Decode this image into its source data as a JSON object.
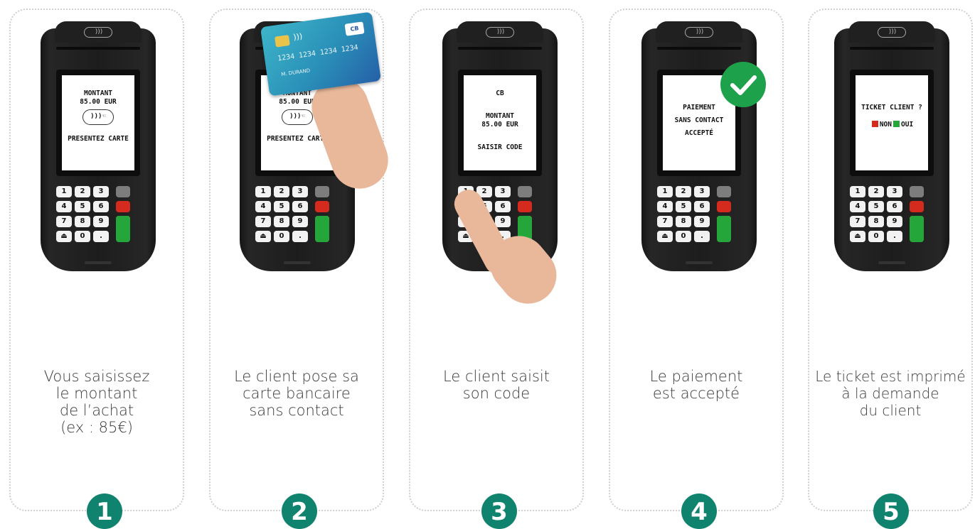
{
  "steps": [
    {
      "number": "1",
      "caption": [
        "Vous saisissez",
        "le montant",
        "de l’achat",
        "(ex : 85€)"
      ]
    },
    {
      "number": "2",
      "caption": [
        "Le client pose sa",
        "carte bancaire",
        "sans contact"
      ]
    },
    {
      "number": "3",
      "caption": [
        "Le client saisit",
        "son code"
      ]
    },
    {
      "number": "4",
      "caption": [
        "Le paiement",
        "est accepté"
      ]
    },
    {
      "number": "5",
      "caption": [
        "Le ticket est imprimé",
        "à la demande",
        "du client"
      ]
    }
  ],
  "screens": {
    "s1": {
      "amount_label": "MONTANT",
      "amount": "85.00 EUR",
      "prompt": "PRESENTEZ CARTE"
    },
    "s2": {
      "amount_label": "MONTANT",
      "amount": "85.00 EUR",
      "prompt": "PRESENTEZ CARTE"
    },
    "s3": {
      "card_type": "CB",
      "amount_label": "MONTANT",
      "amount": "85.00 EUR",
      "prompt": "SAISIR CODE"
    },
    "s4": {
      "line1": "PAIEMENT",
      "line2": "SANS CONTACT",
      "line3": "ACCEPTÉ"
    },
    "s5": {
      "question": "TICKET CLIENT ?",
      "no": "NON",
      "yes": "OUI"
    }
  },
  "bank_card": {
    "number": "1234 1234 1234 1234",
    "name": "M. DURAND",
    "logo": "CB"
  },
  "keypad": [
    "1",
    "2",
    "3",
    "4",
    "5",
    "6",
    "7",
    "8",
    "9",
    "0",
    "."
  ],
  "icons": {
    "contactless": "contactless-icon",
    "check": "check-icon",
    "paper": "paper-feed-icon"
  },
  "colors": {
    "badge": "#10836f",
    "check": "#1ea14b",
    "key_red": "#d52a1e",
    "key_yellow": "#f2c624",
    "key_green": "#24a63a",
    "card": "#2a8fb8"
  }
}
